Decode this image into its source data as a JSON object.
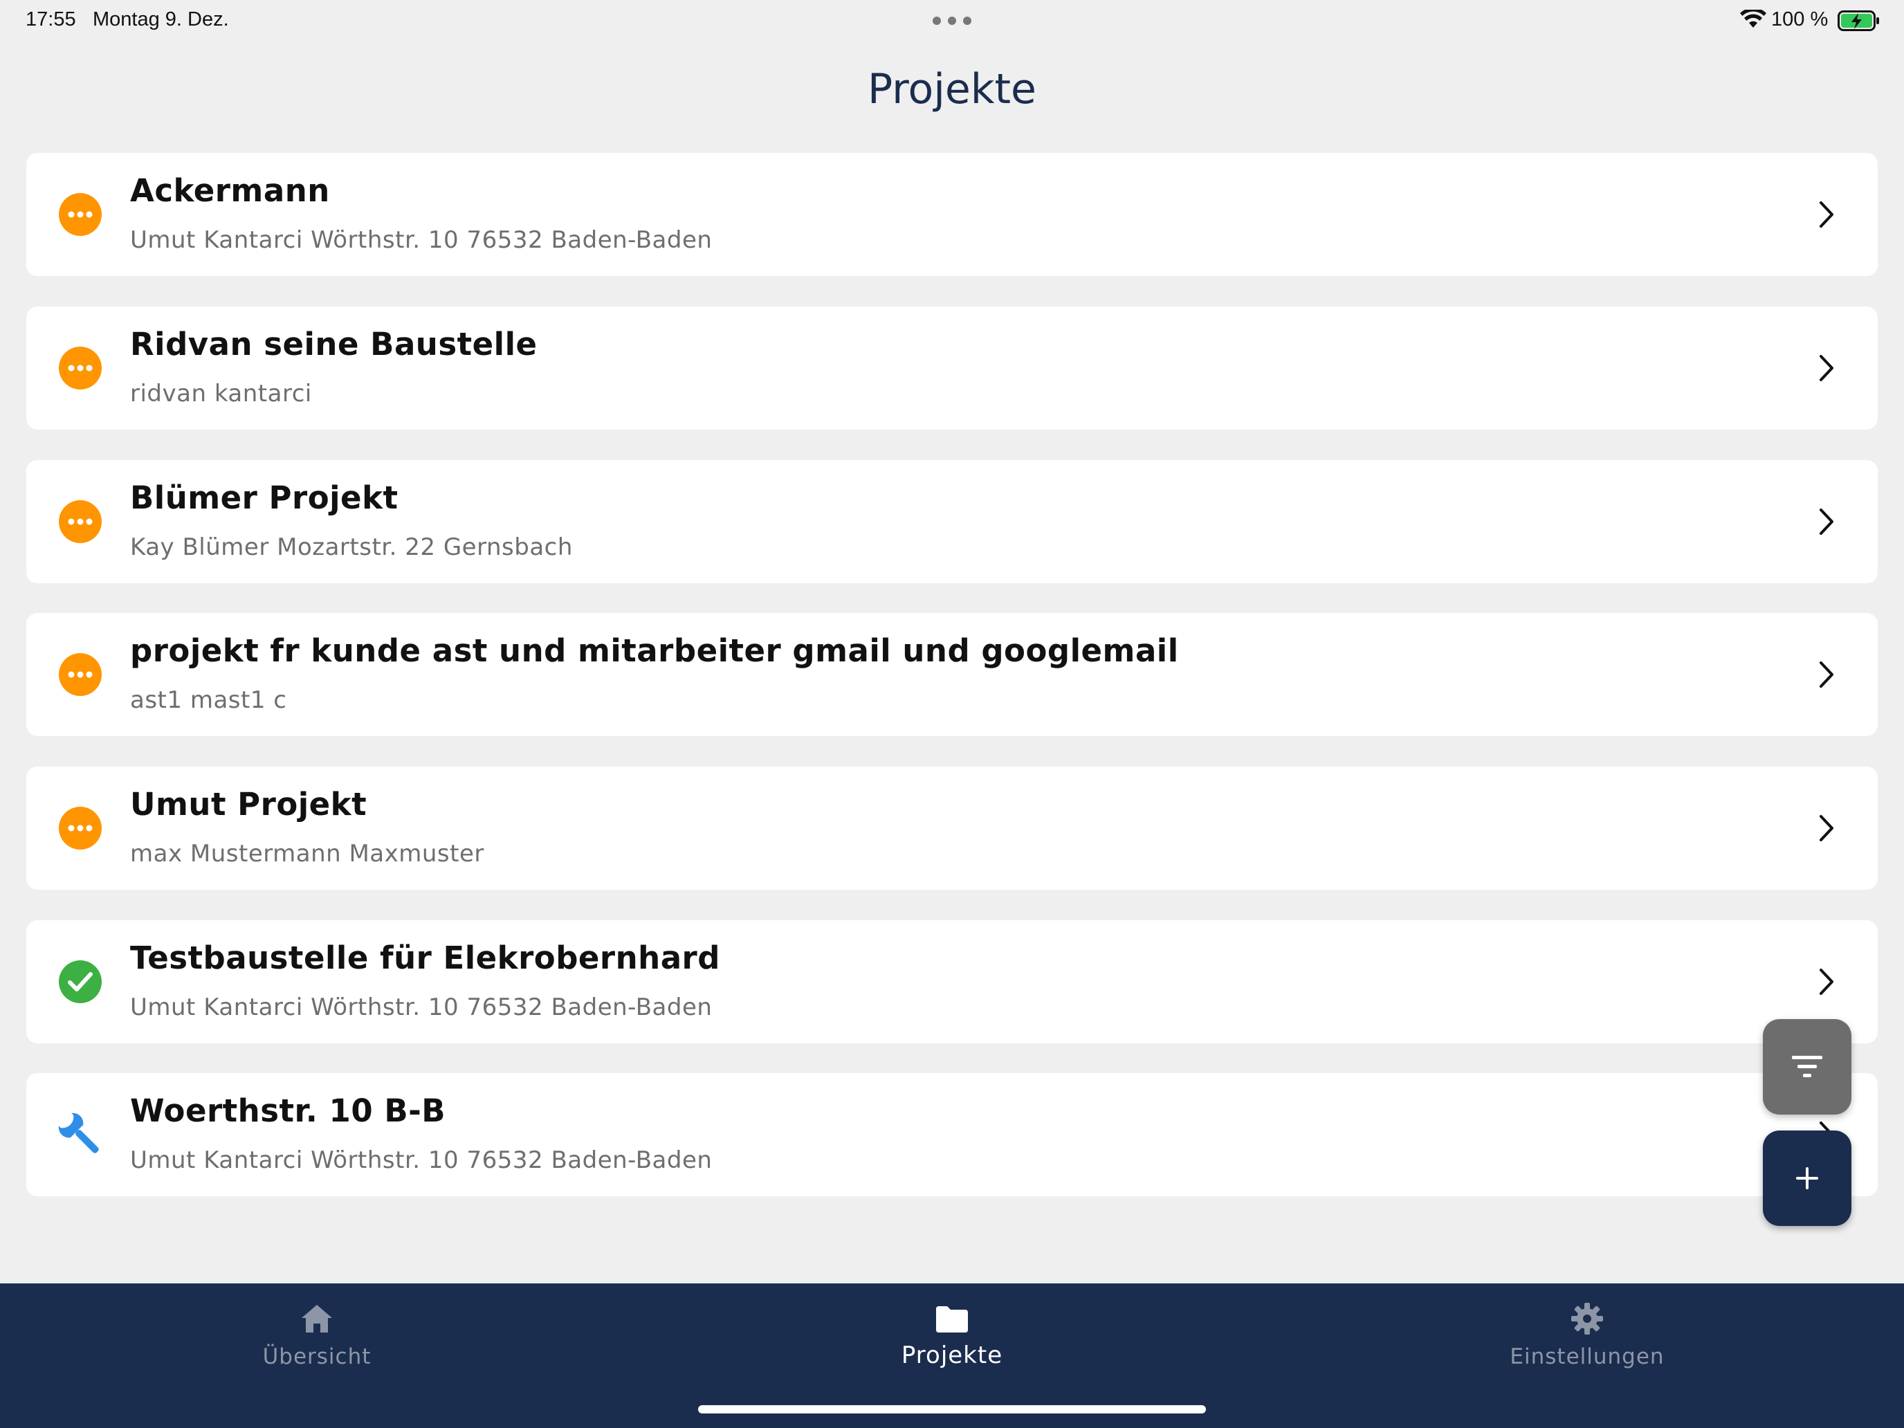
{
  "status_bar": {
    "time": "17:55",
    "date": "Montag 9. Dez.",
    "battery_text": "100 %"
  },
  "header": {
    "title": "Projekte"
  },
  "projects": [
    {
      "title": "Ackermann",
      "subtitle": "Umut Kantarci Wörthstr. 10 76532 Baden-Baden",
      "status": "pending",
      "status_icon": "more-horizontal-icon"
    },
    {
      "title": "Ridvan seine Baustelle",
      "subtitle": "ridvan kantarci",
      "status": "pending",
      "status_icon": "more-horizontal-icon"
    },
    {
      "title": "Blümer Projekt",
      "subtitle": "Kay Blümer Mozartstr. 22 Gernsbach",
      "status": "pending",
      "status_icon": "more-horizontal-icon"
    },
    {
      "title": "projekt fr kunde ast und mitarbeiter gmail und googlemail",
      "subtitle": "ast1 mast1 c",
      "status": "pending",
      "status_icon": "more-horizontal-icon"
    },
    {
      "title": "Umut Projekt",
      "subtitle": "max Mustermann Maxmuster",
      "status": "pending",
      "status_icon": "more-horizontal-icon"
    },
    {
      "title": "Testbaustelle für Elekrobernhard",
      "subtitle": "Umut Kantarci Wörthstr. 10 76532 Baden-Baden",
      "status": "done",
      "status_icon": "check-circle-icon"
    },
    {
      "title": "Woerthstr. 10 B-B",
      "subtitle": "Umut Kantarci Wörthstr. 10 76532 Baden-Baden",
      "status": "in-progress",
      "status_icon": "wrench-icon"
    }
  ],
  "fabs": {
    "filter_icon": "filter-icon",
    "add_icon": "plus-icon"
  },
  "tabbar": {
    "tabs": [
      {
        "label": "Übersicht",
        "icon": "home-icon",
        "active": false
      },
      {
        "label": "Projekte",
        "icon": "folder-icon",
        "active": true
      },
      {
        "label": "Einstellungen",
        "icon": "gear-icon",
        "active": false
      }
    ]
  },
  "colors": {
    "navy": "#1b2d4e",
    "pending_orange": "#ff9500",
    "done_green": "#3cb043",
    "wrench_blue": "#2f8fe8",
    "background": "#efefef"
  }
}
